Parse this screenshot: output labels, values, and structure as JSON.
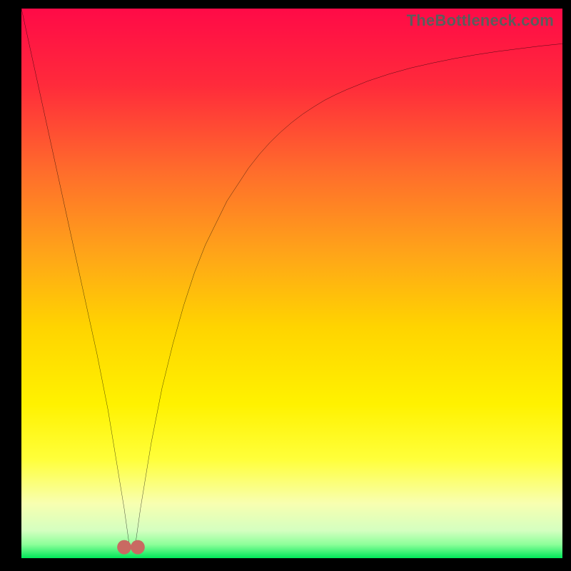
{
  "watermark": "TheBottleneck.com",
  "chart_data": {
    "type": "line",
    "title": "",
    "xlabel": "",
    "ylabel": "",
    "xlim": [
      0,
      100
    ],
    "ylim": [
      0,
      100
    ],
    "grid": false,
    "legend": false,
    "x": [
      0,
      2,
      4,
      6,
      8,
      10,
      12,
      14,
      15,
      16,
      17,
      18,
      19,
      20,
      21,
      22,
      23,
      24,
      26,
      28,
      30,
      32,
      34,
      36,
      38,
      40,
      42,
      44,
      46,
      48,
      50,
      52,
      54,
      56,
      58,
      60,
      64,
      68,
      72,
      76,
      80,
      84,
      88,
      92,
      96,
      100
    ],
    "values": [
      100,
      91,
      82,
      73,
      64,
      55,
      46,
      37,
      32,
      27,
      21,
      15,
      9,
      2,
      2,
      9,
      15,
      21,
      31,
      39,
      46,
      52,
      57,
      61,
      65,
      68,
      71,
      73.5,
      75.7,
      77.6,
      79.3,
      80.8,
      82.1,
      83.3,
      84.3,
      85.2,
      86.8,
      88.1,
      89.2,
      90.1,
      90.9,
      91.6,
      92.2,
      92.7,
      93.2,
      93.6
    ],
    "markers": [
      {
        "x": 19,
        "y": 2
      },
      {
        "x": 21.5,
        "y": 2
      }
    ],
    "background_gradient": {
      "top": "#ff0a47",
      "mid1": "#ff6e2b",
      "mid2": "#ffd400",
      "mid3": "#ffff3a",
      "band": "#f8ffb0",
      "bottom": "#00e759"
    }
  }
}
